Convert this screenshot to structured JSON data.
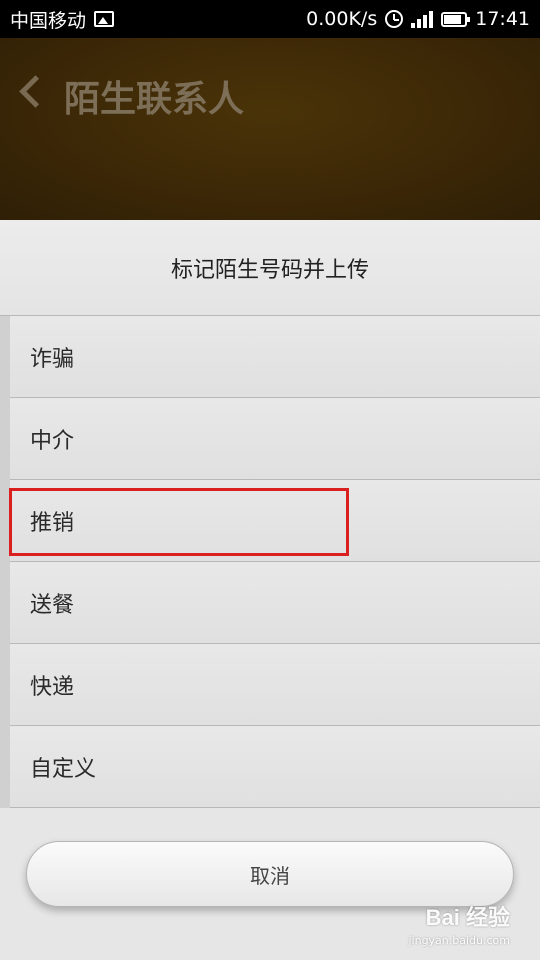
{
  "status_bar": {
    "carrier": "中国移动",
    "speed": "0.00K/s",
    "time": "17:41"
  },
  "header": {
    "title": "陌生联系人"
  },
  "sheet": {
    "title": "标记陌生号码并上传",
    "options": [
      {
        "label": "诈骗"
      },
      {
        "label": "中介"
      },
      {
        "label": "推销"
      },
      {
        "label": "送餐"
      },
      {
        "label": "快递"
      },
      {
        "label": "自定义"
      }
    ],
    "cancel_label": "取消"
  },
  "watermark": {
    "brand": "Bai 经验",
    "url": "jingyan.baidu.com"
  },
  "colors": {
    "highlight": "#d9201f",
    "header_bg": "#3b2707"
  }
}
